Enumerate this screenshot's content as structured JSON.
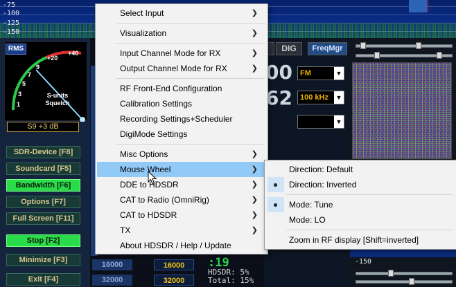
{
  "spectrum": {
    "levels": [
      "-75",
      "-100",
      "-125",
      "-150"
    ]
  },
  "meter": {
    "rms_label": "RMS",
    "scale_ticks": [
      "+40",
      "+20",
      "9",
      "7",
      "5",
      "3",
      "1"
    ],
    "caption_line1": "S-units",
    "caption_line2": "Squelch",
    "readout": "S9 +3 dB"
  },
  "side_buttons": [
    {
      "label": "SDR-Device [F8]",
      "active": false
    },
    {
      "label": "Soundcard [F5]",
      "active": false
    },
    {
      "label": "Bandwidth [F6]",
      "active": true
    },
    {
      "label": "Options [F7]",
      "active": false
    },
    {
      "label": "Full Screen [F11]",
      "active": false
    },
    {
      "label": "Stop [F2]",
      "active": true
    },
    {
      "label": "Minimize [F3]",
      "active": false
    },
    {
      "label": "Exit [F4]",
      "active": false
    }
  ],
  "mode_buttons": {
    "dig": "DIG",
    "freqmgr": "FreqMgr"
  },
  "combos": {
    "mode": "FM",
    "step": "100 kHz",
    "third": ""
  },
  "big_digits": {
    "row1": "00",
    "row2": "62"
  },
  "bandwidth": {
    "left_value": "16000",
    "right_value": "16000",
    "left_value_2": "32000",
    "right_value_2": "32000"
  },
  "clock": ":19",
  "stats": {
    "line1": "HDSDR: 5%",
    "line2": "Total: 15%"
  },
  "waterfall": {
    "level_label": "-150"
  },
  "main_menu": {
    "items": [
      {
        "label": "Select Input",
        "submenu": true
      },
      {
        "label": "Visualization",
        "submenu": true
      },
      {
        "label": "Input Channel Mode for RX",
        "submenu": true
      },
      {
        "label": "Output Channel Mode for RX",
        "submenu": true
      },
      {
        "label": "RF Front-End Configuration",
        "submenu": false
      },
      {
        "label": "Calibration Settings",
        "submenu": false
      },
      {
        "label": "Recording Settings+Scheduler",
        "submenu": false
      },
      {
        "label": "DigiMode Settings",
        "submenu": false
      },
      {
        "label": "Misc Options",
        "submenu": true
      },
      {
        "label": "Mouse Wheel",
        "submenu": true,
        "highlighted": true
      },
      {
        "label": "DDE to HDSDR",
        "submenu": true
      },
      {
        "label": "CAT to Radio (OmniRig)",
        "submenu": true
      },
      {
        "label": "CAT to HDSDR",
        "submenu": true
      },
      {
        "label": "TX",
        "submenu": true
      },
      {
        "label": "About HDSDR / Help / Update",
        "submenu": false
      }
    ]
  },
  "mouse_wheel_menu": {
    "items": [
      {
        "label": "Direction: Default",
        "selected": false
      },
      {
        "label": "Direction: Inverted",
        "selected": true
      },
      {
        "label": "Mode: Tune",
        "selected": true
      },
      {
        "label": "Mode: LO",
        "selected": false
      },
      {
        "label": "Zoom in RF display [Shift=inverted]",
        "selected": false
      }
    ]
  },
  "icons": {
    "submenu_arrow": "chevron-right-icon",
    "radio_bullet": "bullet-icon",
    "cursor": "mouse-pointer-icon"
  },
  "colors": {
    "menu_highlight": "#91c9f7",
    "active_button": "#2bdc4a",
    "readout": "#f2c418"
  }
}
